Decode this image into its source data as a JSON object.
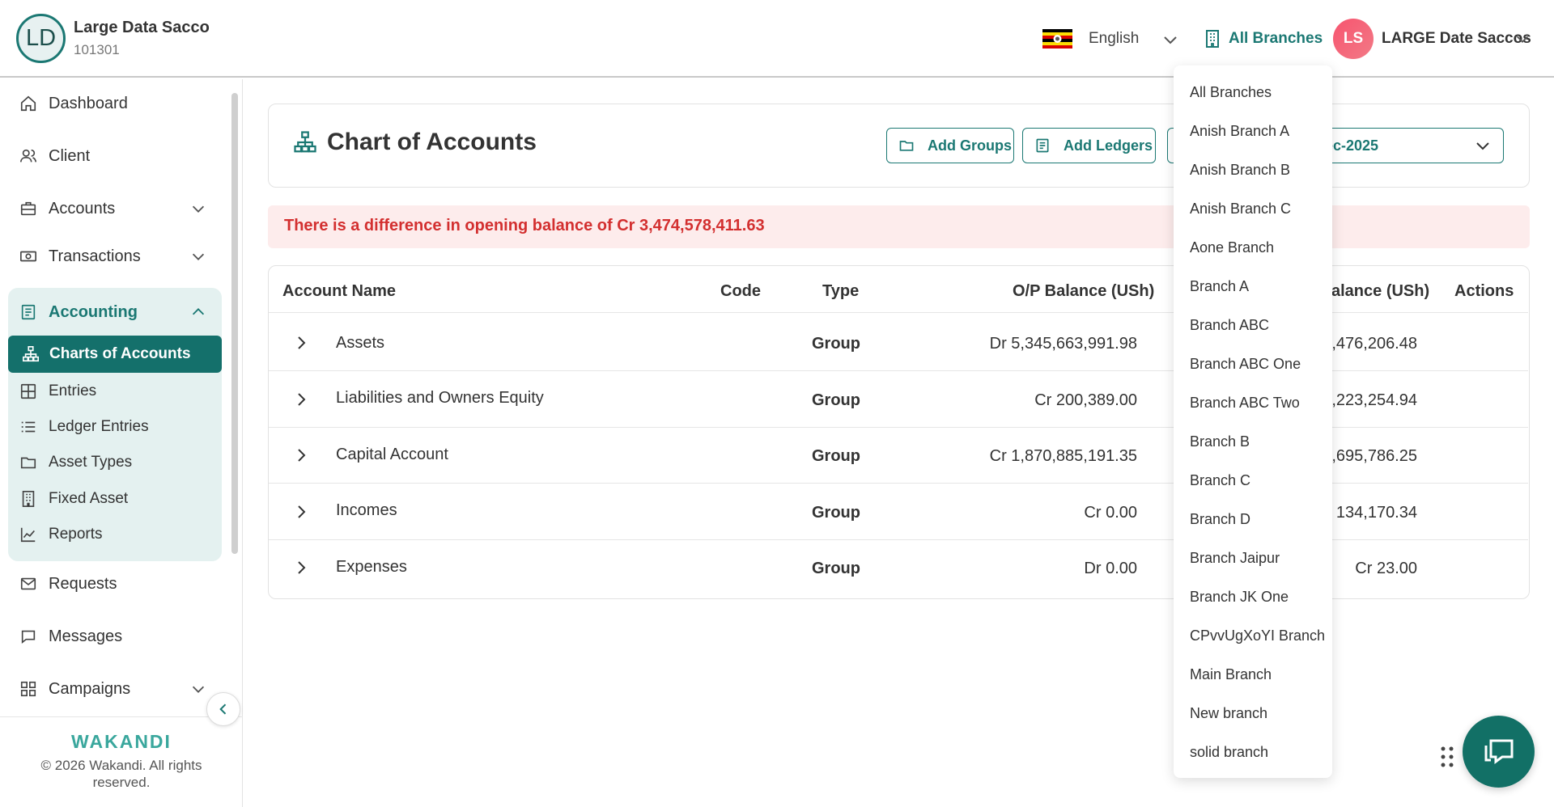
{
  "header": {
    "org_initials": "LD",
    "org_name": "Large Data Sacco",
    "org_code": "101301",
    "language": "English",
    "branch_selected": "All Branches",
    "user_initials": "LS",
    "user_name": "LARGE Date Saccos"
  },
  "sidebar": {
    "items": [
      {
        "label": "Dashboard",
        "icon": "home-icon"
      },
      {
        "label": "Client",
        "icon": "users-icon"
      },
      {
        "label": "Accounts",
        "icon": "briefcase-icon"
      },
      {
        "label": "Transactions",
        "icon": "cash-icon"
      },
      {
        "label": "Requests",
        "icon": "mail-icon"
      },
      {
        "label": "Messages",
        "icon": "chat-icon"
      },
      {
        "label": "Campaigns",
        "icon": "grid-icon"
      }
    ],
    "accounting": {
      "label": "Accounting",
      "sub": [
        {
          "label": "Charts of Accounts",
          "icon": "hierarchy-icon"
        },
        {
          "label": "Entries",
          "icon": "table-icon"
        },
        {
          "label": "Ledger Entries",
          "icon": "list-icon"
        },
        {
          "label": "Asset Types",
          "icon": "folder-icon"
        },
        {
          "label": "Fixed Asset",
          "icon": "building-icon"
        },
        {
          "label": "Reports",
          "icon": "chart-line-icon"
        }
      ]
    },
    "footer_logo": "WAKANDI",
    "footer_copyright": "© 2026 Wakandi. All rights reserved."
  },
  "main": {
    "title": "Chart of Accounts",
    "add_groups_label": "Add Groups",
    "add_ledgers_label": "Add Ledgers",
    "date_value": "ec-2025",
    "alert": "There is a difference in opening balance of Cr 3,474,578,411.63",
    "columns": [
      "Account Name",
      "Code",
      "Type",
      "O/P Balance (USh)",
      "alance (USh)",
      "Actions"
    ],
    "rows": [
      {
        "name": "Assets",
        "code": "",
        "type": "Group",
        "op": "Dr 5,345,663,991.98",
        "cl": "",
        "cl_partial": "',476,206.48"
      },
      {
        "name": "Liabilities and Owners Equity",
        "code": "",
        "type": "Group",
        "op": "Cr 200,389.00",
        "cl_partial": "',223,254.94"
      },
      {
        "name": "Capital Account",
        "code": "",
        "type": "Group",
        "op": "Cr 1,870,885,191.35",
        "cl_partial": "i,695,786.25"
      },
      {
        "name": "Incomes",
        "code": "",
        "type": "Group",
        "op": "Cr 0.00",
        "cl_partial": "' 134,170.34"
      },
      {
        "name": "Expenses",
        "code": "",
        "type": "Group",
        "op": "Dr 0.00",
        "cl_partial": "Cr 23.00"
      }
    ]
  },
  "branch_dropdown": {
    "options": [
      "All Branches",
      "Anish Branch A",
      "Anish Branch B",
      "Anish Branch C",
      "Aone Branch",
      "Branch A",
      "Branch ABC",
      "Branch ABC One",
      "Branch ABC Two",
      "Branch B",
      "Branch C",
      "Branch D",
      "Branch Jaipur",
      "Branch JK One",
      "CPvvUgXoYI Branch",
      "Main Branch",
      "New branch",
      "solid branch"
    ]
  },
  "colors": {
    "primary": "#1b7873",
    "active_bg": "#14706b",
    "group_bg": "#e4f1f0",
    "alert_bg": "#fdecec",
    "alert_text": "#d32f2f",
    "avatar_user": "#f7546f"
  }
}
